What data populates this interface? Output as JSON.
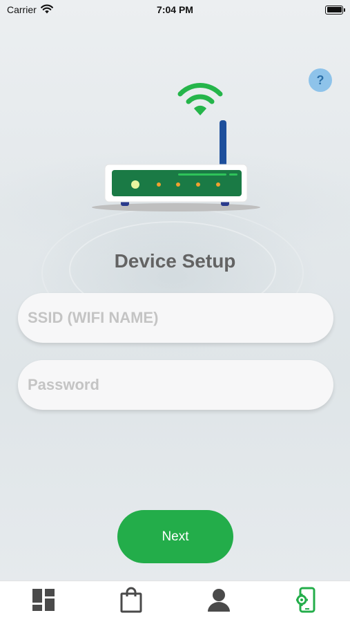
{
  "status_bar": {
    "carrier": "Carrier",
    "time": "7:04 PM",
    "icons": [
      "wifi-icon",
      "battery-icon"
    ]
  },
  "help": {
    "label": "?"
  },
  "illustration": {
    "icon": "router-wifi-icon"
  },
  "title": "Device Setup",
  "form": {
    "ssid": {
      "placeholder": "SSID (WIFI NAME)",
      "value": ""
    },
    "password": {
      "placeholder": "Password",
      "value": ""
    }
  },
  "next_button": {
    "label": "Next"
  },
  "tab_bar": {
    "tabs": [
      {
        "icon": "dashboard-icon",
        "active": false
      },
      {
        "icon": "shopping-bag-icon",
        "active": false
      },
      {
        "icon": "profile-icon",
        "active": false
      },
      {
        "icon": "device-settings-icon",
        "active": true
      }
    ]
  },
  "colors": {
    "accent": "#23ad4a",
    "help": "#8ec3ea",
    "title": "#636363",
    "tab_inactive": "#4a4a4a"
  }
}
